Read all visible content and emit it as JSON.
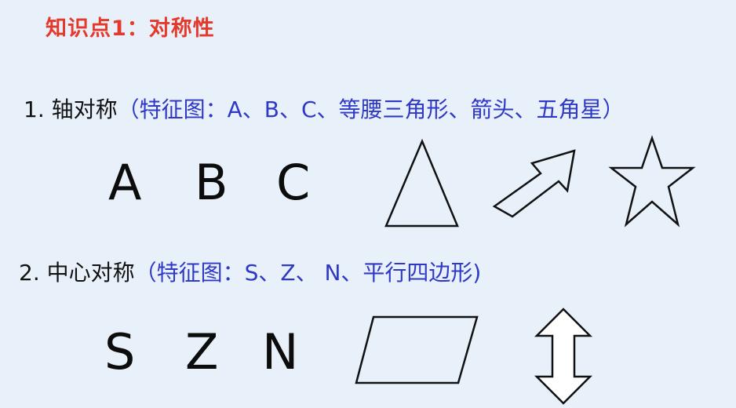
{
  "title": "知识点1：对称性",
  "section1": {
    "label": "1. 轴对称",
    "detail": "（特征图：A、B、C、等腰三角形、箭头、五角星）",
    "letters": [
      "A",
      "B",
      "C"
    ],
    "shapes": [
      "isosceles-triangle",
      "arrow",
      "five-pointed-star"
    ]
  },
  "section2": {
    "label": "2. 中心对称",
    "detail": "（特征图：S、Z、 N、平行四边形)",
    "letters": [
      "S",
      "Z",
      "N"
    ],
    "shapes": [
      "parallelogram",
      "double-headed-arrow"
    ]
  },
  "colors": {
    "title": "#e53a2b",
    "detail": "#2f39c7",
    "background": "#e8f0fa"
  }
}
